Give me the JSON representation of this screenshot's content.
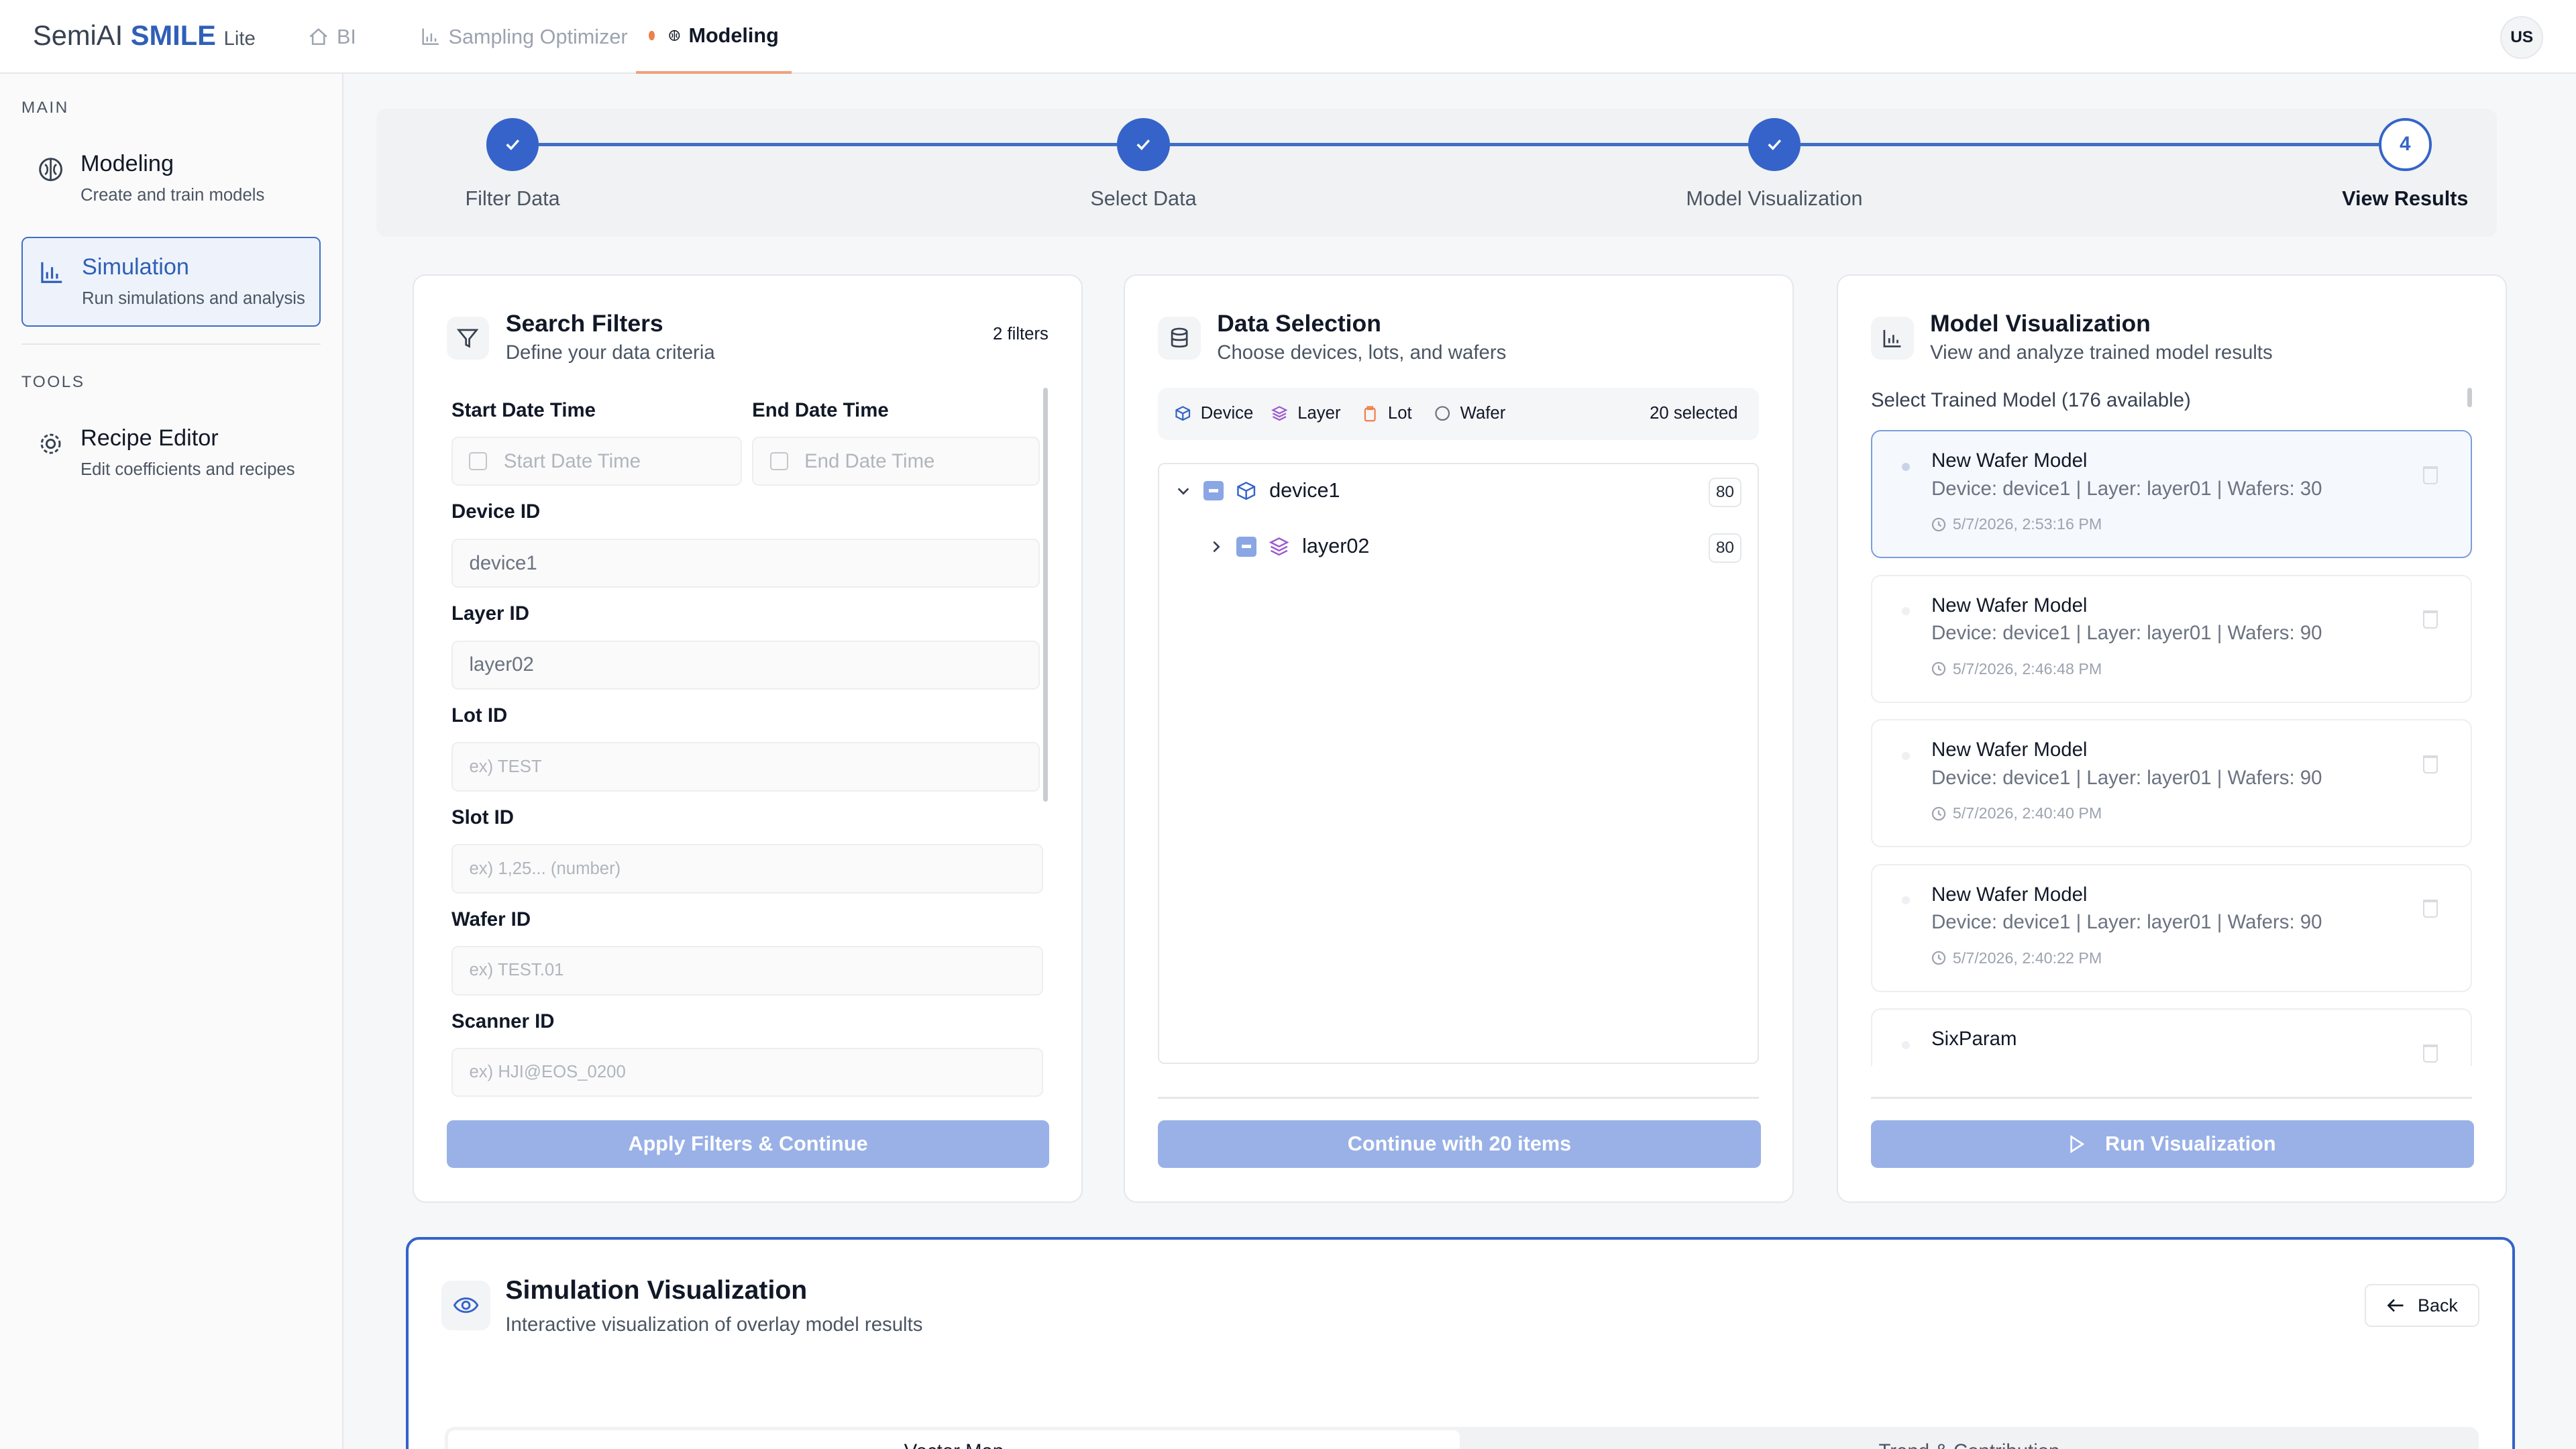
{
  "brand": {
    "part1": "SemiAI",
    "part2": "SMILE",
    "part3": "Lite"
  },
  "topnav": [
    {
      "label": "BI",
      "icon": "home-icon"
    },
    {
      "label": "Sampling Optimizer",
      "icon": "bar-chart-icon"
    },
    {
      "label": "Modeling",
      "icon": "brain-icon"
    }
  ],
  "user": {
    "initials": "US"
  },
  "sidebar": {
    "main_label": "MAIN",
    "tools_label": "TOOLS",
    "items": [
      {
        "title": "Modeling",
        "subtitle": "Create and train models"
      },
      {
        "title": "Simulation",
        "subtitle": "Run simulations and analysis"
      },
      {
        "title": "Recipe Editor",
        "subtitle": "Edit coefficients and recipes"
      }
    ]
  },
  "stepper": {
    "steps": [
      {
        "label": "Filter Data",
        "state": "done"
      },
      {
        "label": "Select Data",
        "state": "done"
      },
      {
        "label": "Model Visualization",
        "state": "done"
      },
      {
        "label": "View Results",
        "state": "current",
        "number": "4"
      }
    ]
  },
  "search_filters": {
    "title": "Search Filters",
    "subtitle": "Define your data criteria",
    "badge": "2 filters",
    "start_label": "Start Date Time",
    "start_placeholder": "Start Date Time",
    "end_label": "End Date Time",
    "end_placeholder": "End Date Time",
    "device_label": "Device ID",
    "device_value": "device1",
    "layer_label": "Layer ID",
    "layer_value": "layer02",
    "lot_label": "Lot ID",
    "lot_placeholder": "ex) TEST",
    "slot_label": "Slot ID",
    "slot_placeholder": "ex) 1,25... (number)",
    "wafer_label": "Wafer ID",
    "wafer_placeholder": "ex) TEST.01",
    "scanner_label": "Scanner ID",
    "scanner_placeholder": "ex) HJI@EOS_0200",
    "button": "Apply Filters & Continue"
  },
  "data_selection": {
    "title": "Data Selection",
    "subtitle": "Choose devices, lots, and wafers",
    "filters": [
      "Device",
      "Layer",
      "Lot",
      "Wafer"
    ],
    "selected": "20 selected",
    "tree": [
      {
        "label": "device1",
        "count": "80"
      },
      {
        "label": "layer02",
        "count": "80"
      }
    ],
    "button": "Continue with 20 items"
  },
  "model_viz": {
    "title": "Model Visualization",
    "subtitle": "View and analyze trained model results",
    "select_label": "Select Trained Model (176 available)",
    "models": [
      {
        "name": "New Wafer Model",
        "desc": "Device: device1 | Layer: layer01 | Wafers: 30",
        "time": "5/7/2026, 2:53:16 PM"
      },
      {
        "name": "New Wafer Model",
        "desc": "Device: device1 | Layer: layer01 | Wafers: 90",
        "time": "5/7/2026, 2:46:48 PM"
      },
      {
        "name": "New Wafer Model",
        "desc": "Device: device1 | Layer: layer01 | Wafers: 90",
        "time": "5/7/2026, 2:40:40 PM"
      },
      {
        "name": "New Wafer Model",
        "desc": "Device: device1 | Layer: layer01 | Wafers: 90",
        "time": "5/7/2026, 2:40:22 PM"
      },
      {
        "name": "SixParam",
        "desc": "",
        "time": ""
      }
    ],
    "button": "Run Visualization"
  },
  "sim_viz": {
    "title": "Simulation Visualization",
    "subtitle": "Interactive visualization of overlay model results",
    "back": "Back",
    "tabs": [
      "Vector Map",
      "Trend & Contribution"
    ]
  },
  "colors": {
    "accent": "#3563c9",
    "button_disabled": "#99b1e7",
    "nav_dot": "#f07f4b"
  }
}
